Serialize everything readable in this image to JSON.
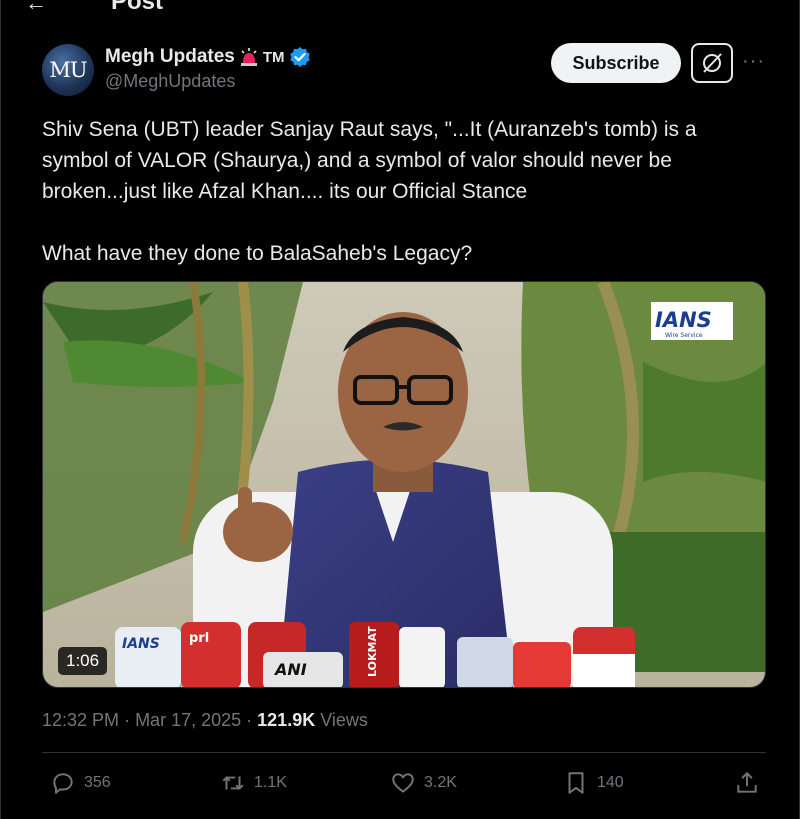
{
  "header": {
    "title": "Post"
  },
  "author": {
    "avatar_text": "MU",
    "display_name": "Megh Updates",
    "tm": "TM",
    "handle": "@MeghUpdates"
  },
  "buttons": {
    "subscribe": "Subscribe"
  },
  "tweet": {
    "text": "Shiv Sena (UBT) leader Sanjay Raut says, \"...It (Auranzeb's tomb) is a symbol of VALOR (Shaurya,) and a symbol of valor should never be broken...just like Afzal Khan.... its our Official Stance\n\nWhat have they done to BalaSaheb's Legacy?",
    "video_duration": "1:06",
    "watermark": "IANS",
    "watermark_sub": "Wire Service",
    "mic_labels": [
      "IANS",
      "prl",
      "ANI",
      "LOKMAT"
    ]
  },
  "meta": {
    "time": "12:32 PM",
    "date": "Mar 17, 2025",
    "views_count": "121.9K",
    "views_label": "Views"
  },
  "actions": {
    "replies": "356",
    "reposts": "1.1K",
    "likes": "3.2K",
    "bookmarks": "140"
  },
  "colors": {
    "background": "#000000",
    "text": "#e7e9ea",
    "muted": "#71767b",
    "verified_blue": "#1d9bf0",
    "border": "#2f3336"
  }
}
